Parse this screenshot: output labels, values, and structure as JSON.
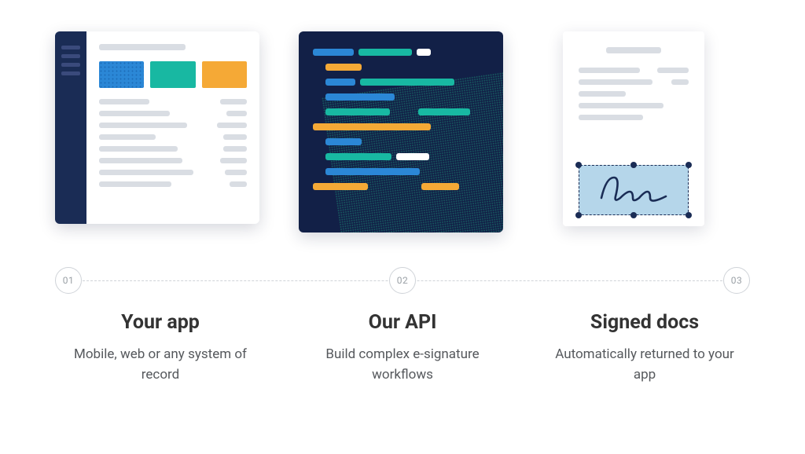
{
  "steps": [
    {
      "num": "01",
      "title": "Your app",
      "desc": "Mobile, web or any system of record"
    },
    {
      "num": "02",
      "title": "Our API",
      "desc": "Build complex e-signature workflows"
    },
    {
      "num": "03",
      "title": "Signed docs",
      "desc": "Automatically returned to your app"
    }
  ],
  "colors": {
    "navy": "#1a2c55",
    "blue": "#2b87d6",
    "cyan": "#18b8a2",
    "orange": "#f5a936",
    "grey": "#d9dde3",
    "lightblue": "#b5d6ea"
  }
}
